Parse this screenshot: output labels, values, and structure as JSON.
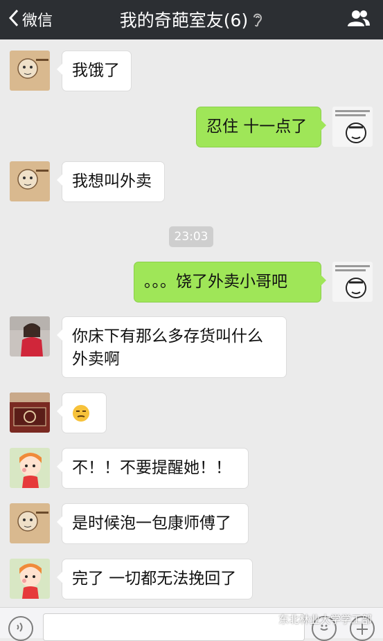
{
  "nav": {
    "back_label": "微信",
    "title": "我的奇葩室友(6)"
  },
  "timestamp": "23:03",
  "messages": [
    {
      "side": "left",
      "text": "我饿了"
    },
    {
      "side": "right",
      "text": "忍住 十一点了"
    },
    {
      "side": "left",
      "text": "我想叫外卖"
    },
    {
      "side": "right",
      "text": "。。。饶了外卖小哥吧"
    },
    {
      "side": "left",
      "text": "你床下有那么多存货叫什么外卖啊"
    },
    {
      "side": "left",
      "text": "😒"
    },
    {
      "side": "left",
      "text": "不！！不要提醒她！！"
    },
    {
      "side": "left",
      "text": "是时候泡一包康师傅了"
    },
    {
      "side": "left",
      "text": "完了 一切都无法挽回了"
    }
  ],
  "input": {
    "placeholder": ""
  },
  "watermark": "东北林业大学学工部",
  "colors": {
    "navbar": "#2c2f33",
    "bubble_right": "#9fe658",
    "bubble_left": "#ffffff",
    "background": "#ebebeb"
  }
}
